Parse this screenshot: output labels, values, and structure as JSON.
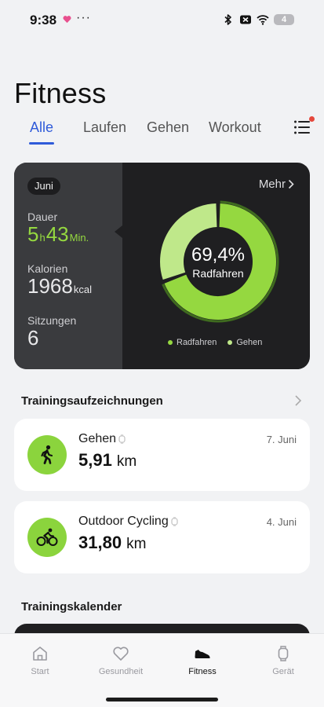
{
  "status": {
    "time": "9:38",
    "dots": "···",
    "battery": "4",
    "colors": {
      "heart": "#e8508e"
    }
  },
  "title": "Fitness",
  "tabs": [
    {
      "label": "Alle",
      "active": true
    },
    {
      "label": "Laufen",
      "active": false
    },
    {
      "label": "Gehen",
      "active": false
    },
    {
      "label": "Workout",
      "active": false
    }
  ],
  "summary": {
    "month": "Juni",
    "more": "Mehr",
    "duration": {
      "label": "Dauer",
      "hours": "5",
      "hours_unit": "h",
      "minutes": "43",
      "minutes_unit": "Min."
    },
    "calories": {
      "label": "Kalorien",
      "value": "1968",
      "unit": "kcal"
    },
    "sessions": {
      "label": "Sitzungen",
      "value": "6"
    },
    "donut": {
      "percent_text": "69,4%",
      "label": "Radfahren",
      "radfahren_fraction": 0.694,
      "gehen_fraction": 0.306,
      "colors": {
        "radfahren": "#95d840",
        "gehen": "#bfe88a",
        "ring": "#3f6b1f"
      }
    },
    "legend": [
      {
        "label": "Radfahren",
        "color": "#95d840"
      },
      {
        "label": "Gehen",
        "color": "#bfe88a"
      }
    ]
  },
  "records": {
    "title": "Trainingsaufzeichnungen",
    "items": [
      {
        "name": "Gehen",
        "value": "5,91",
        "unit": "km",
        "date": "7. Juni",
        "icon": "walking-icon"
      },
      {
        "name": "Outdoor Cycling",
        "value": "31,80",
        "unit": "km",
        "date": "4. Juni",
        "icon": "cycling-icon"
      }
    ]
  },
  "calendar": {
    "title": "Trainingskalender"
  },
  "nav": [
    {
      "label": "Start",
      "icon": "home-icon",
      "active": false
    },
    {
      "label": "Gesundheit",
      "icon": "heart-icon",
      "active": false
    },
    {
      "label": "Fitness",
      "icon": "shoe-icon",
      "active": true
    },
    {
      "label": "Gerät",
      "icon": "watch-icon",
      "active": false
    }
  ],
  "accent": "#2f5bd9"
}
